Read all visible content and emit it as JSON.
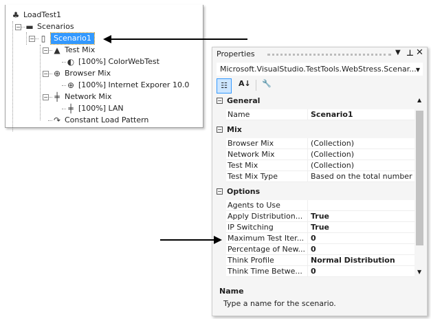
{
  "tree": {
    "items": [
      {
        "label": "LoadTest1",
        "icon": "load-test-icon"
      },
      {
        "label": "Scenarios",
        "icon": "folder-icon"
      },
      {
        "label": "Scenario1",
        "icon": "scenario-icon",
        "selected": true
      },
      {
        "label": "Test Mix",
        "icon": "flask-icon"
      },
      {
        "label": "[100%] ColorWebTest",
        "icon": "web-test-icon"
      },
      {
        "label": "Browser Mix",
        "icon": "browser-icon"
      },
      {
        "label": "[100%] Internet Exporer 10.0",
        "icon": "browser-icon"
      },
      {
        "label": "Network Mix",
        "icon": "network-icon"
      },
      {
        "label": "[100%] LAN",
        "icon": "network-icon"
      },
      {
        "label": "Constant Load Pattern",
        "icon": "load-pattern-icon"
      }
    ]
  },
  "properties": {
    "title": "Properties",
    "object": "Microsoft.VisualStudio.TestTools.WebStress.Scenar...",
    "categories": [
      {
        "name": "General",
        "rows": [
          {
            "k": "Name",
            "v": "Scenario1",
            "bold": true
          }
        ]
      },
      {
        "name": "Mix",
        "rows": [
          {
            "k": "Browser Mix",
            "v": "(Collection)"
          },
          {
            "k": "Network Mix",
            "v": "(Collection)"
          },
          {
            "k": "Test Mix",
            "v": "(Collection)"
          },
          {
            "k": "Test Mix Type",
            "v": "Based on the total number"
          }
        ]
      },
      {
        "name": "Options",
        "rows": [
          {
            "k": "Agents to Use",
            "v": ""
          },
          {
            "k": "Apply Distribution...",
            "v": "True",
            "bold": true
          },
          {
            "k": "IP Switching",
            "v": "True",
            "bold": true
          },
          {
            "k": "Maximum Test Iter...",
            "v": "0",
            "bold": true
          },
          {
            "k": "Percentage of New...",
            "v": "0",
            "bold": true
          },
          {
            "k": "Think Profile",
            "v": "Normal Distribution",
            "bold": true
          },
          {
            "k": "Think Time Betwe...",
            "v": "0",
            "bold": true
          }
        ]
      }
    ],
    "description": {
      "title": "Name",
      "text": "Type a name for the scenario."
    }
  }
}
